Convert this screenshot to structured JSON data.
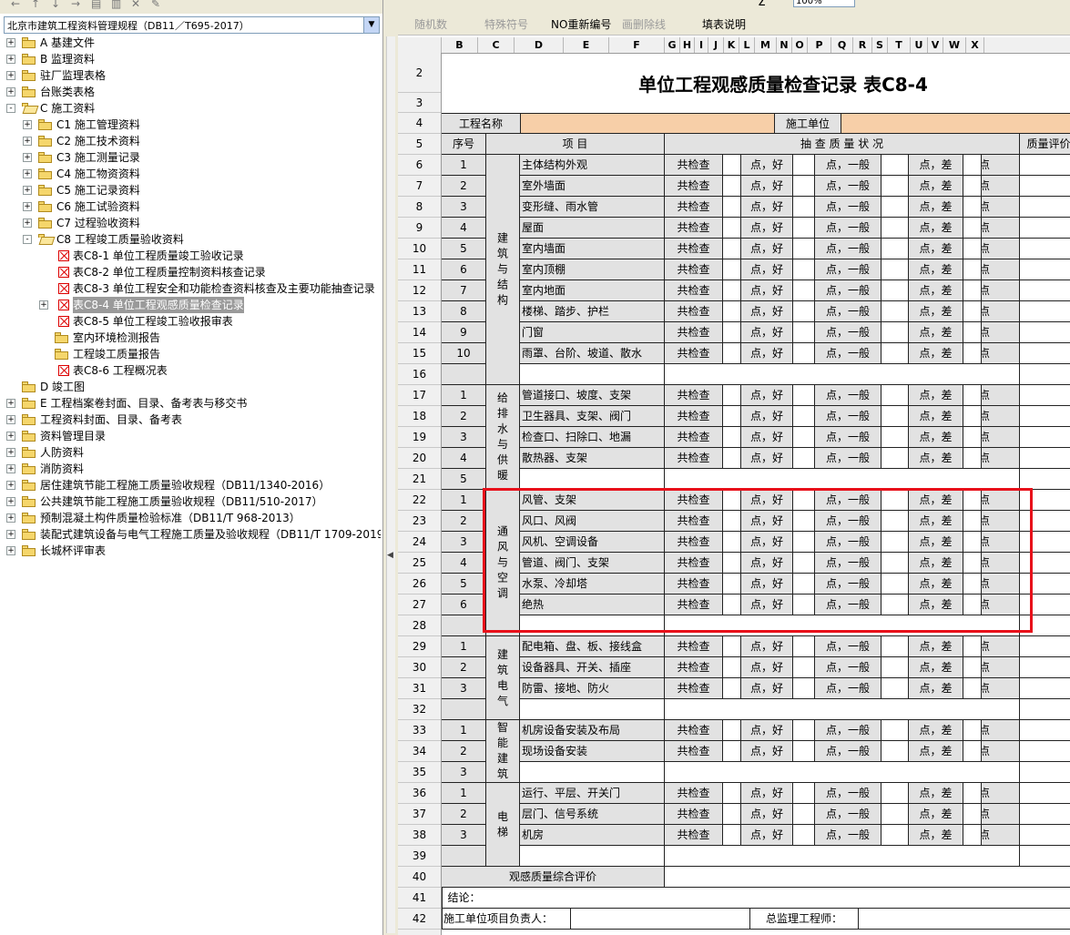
{
  "left_panel": {
    "toolbar_glyphs": [
      "←",
      "↑",
      "↓",
      "→",
      "▤",
      "▥",
      "✕",
      "✎"
    ],
    "combo_value": "北京市建筑工程资料管理规程（DB11／T695-2017）",
    "tree": [
      {
        "label": "A 基建文件",
        "level": 0,
        "expander": "+",
        "icon": "folder"
      },
      {
        "label": "B 监理资料",
        "level": 0,
        "expander": "+",
        "icon": "folder"
      },
      {
        "label": "驻厂监理表格",
        "level": 0,
        "expander": "+",
        "icon": "folder"
      },
      {
        "label": "台账类表格",
        "level": 0,
        "expander": "+",
        "icon": "folder"
      },
      {
        "label": "C 施工资料",
        "level": 0,
        "expander": "-",
        "icon": "folder-open"
      },
      {
        "label": "C1 施工管理资料",
        "level": 1,
        "expander": "+",
        "icon": "folder"
      },
      {
        "label": "C2 施工技术资料",
        "level": 1,
        "expander": "+",
        "icon": "folder"
      },
      {
        "label": "C3 施工测量记录",
        "level": 1,
        "expander": "+",
        "icon": "folder"
      },
      {
        "label": "C4 施工物资资料",
        "level": 1,
        "expander": "+",
        "icon": "folder"
      },
      {
        "label": "C5 施工记录资料",
        "level": 1,
        "expander": "+",
        "icon": "folder"
      },
      {
        "label": "C6 施工试验资料",
        "level": 1,
        "expander": "+",
        "icon": "folder"
      },
      {
        "label": "C7 过程验收资料",
        "level": 1,
        "expander": "+",
        "icon": "folder"
      },
      {
        "label": "C8 工程竣工质量验收资料",
        "level": 1,
        "expander": "-",
        "icon": "folder-open"
      },
      {
        "label": "表C8-1 单位工程质量竣工验收记录",
        "level": 2,
        "expander": "",
        "icon": "doc"
      },
      {
        "label": "表C8-2 单位工程质量控制资料核查记录",
        "level": 2,
        "expander": "",
        "icon": "doc"
      },
      {
        "label": "表C8-3 单位工程安全和功能检查资料核查及主要功能抽查记录",
        "level": 2,
        "expander": "",
        "icon": "doc"
      },
      {
        "label": "表C8-4 单位工程观感质量检查记录",
        "level": 2,
        "expander": "+",
        "icon": "doc",
        "selected": true
      },
      {
        "label": "表C8-5 单位工程竣工验收报审表",
        "level": 2,
        "expander": "",
        "icon": "doc"
      },
      {
        "label": "室内环境检测报告",
        "level": 2,
        "expander": "",
        "icon": "folder"
      },
      {
        "label": "工程竣工质量报告",
        "level": 2,
        "expander": "",
        "icon": "folder"
      },
      {
        "label": "表C8-6 工程概况表",
        "level": 2,
        "expander": "",
        "icon": "doc"
      },
      {
        "label": "D 竣工图",
        "level": 0,
        "expander": "",
        "icon": "folder"
      },
      {
        "label": "E 工程档案卷封面、目录、备考表与移交书",
        "level": 0,
        "expander": "+",
        "icon": "folder"
      },
      {
        "label": "工程资料封面、目录、备考表",
        "level": 0,
        "expander": "+",
        "icon": "folder"
      },
      {
        "label": "资料管理目录",
        "level": 0,
        "expander": "+",
        "icon": "folder"
      },
      {
        "label": "人防资料",
        "level": 0,
        "expander": "+",
        "icon": "folder"
      },
      {
        "label": "消防资料",
        "level": 0,
        "expander": "+",
        "icon": "folder"
      },
      {
        "label": "居住建筑节能工程施工质量验收规程（DB11/1340-2016）",
        "level": 0,
        "expander": "+",
        "icon": "folder"
      },
      {
        "label": "公共建筑节能工程施工质量验收规程（DB11/510-2017）",
        "level": 0,
        "expander": "+",
        "icon": "folder"
      },
      {
        "label": "预制混凝土构件质量检验标准（DB11/T 968-2013）",
        "level": 0,
        "expander": "+",
        "icon": "folder"
      },
      {
        "label": "装配式建筑设备与电气工程施工质量及验收规程（DB11/T 1709-2019）",
        "level": 0,
        "expander": "+",
        "icon": "folder"
      },
      {
        "label": "长城杯评审表",
        "level": 0,
        "expander": "+",
        "icon": "folder"
      }
    ]
  },
  "toolbar": {
    "sigma": "Σ",
    "zoom": "100%",
    "items": [
      {
        "label": "随机数",
        "disabled": true
      },
      {
        "label": "特殊符号",
        "disabled": true
      },
      {
        "label": "NO重新编号",
        "disabled": false
      },
      {
        "label": "画删除线",
        "disabled": true
      },
      {
        "label": "填表说明",
        "disabled": false
      }
    ]
  },
  "sheet": {
    "columns": [
      "B",
      "C",
      "D",
      "E",
      "F",
      "G",
      "H",
      "I",
      "J",
      "K",
      "L",
      "M",
      "N",
      "O",
      "P",
      "Q",
      "R",
      "S",
      "T",
      "U",
      "V",
      "W",
      "X"
    ],
    "row_numbers": [
      "2",
      "3",
      "4",
      "5",
      "6",
      "7",
      "8",
      "9",
      "10",
      "11",
      "12",
      "13",
      "14",
      "15",
      "16",
      "17",
      "18",
      "19",
      "20",
      "21",
      "22",
      "23",
      "24",
      "25",
      "26",
      "27",
      "28",
      "29",
      "30",
      "31",
      "32",
      "33",
      "34",
      "35",
      "36",
      "37",
      "38",
      "39",
      "40",
      "41",
      "42"
    ],
    "title": "单位工程观感质量检查记录  表C8-4",
    "project_name_label": "工程名称",
    "contractor_label": "施工单位",
    "hdr_seq": "序号",
    "hdr_item": "项          目",
    "hdr_status": "抽    查    质    量    状    况",
    "hdr_eval": "质量评价",
    "check_total": "共检查",
    "good": "点，好",
    "normal": "点，一般",
    "poor": "点，差",
    "point": "点",
    "groups": [
      {
        "name": "建筑与结构",
        "items": [
          {
            "seq": "1",
            "text": "主体结构外观"
          },
          {
            "seq": "2",
            "text": "室外墙面"
          },
          {
            "seq": "3",
            "text": "变形缝、雨水管"
          },
          {
            "seq": "4",
            "text": "屋面"
          },
          {
            "seq": "5",
            "text": "室内墙面"
          },
          {
            "seq": "6",
            "text": "室内顶棚"
          },
          {
            "seq": "7",
            "text": "室内地面"
          },
          {
            "seq": "8",
            "text": "楼梯、踏步、护栏"
          },
          {
            "seq": "9",
            "text": "门窗"
          },
          {
            "seq": "10",
            "text": "雨罩、台阶、坡道、散水"
          },
          {
            "seq": "",
            "text": ""
          }
        ]
      },
      {
        "name": "给排水与供暖",
        "items": [
          {
            "seq": "1",
            "text": "管道接口、坡度、支架"
          },
          {
            "seq": "2",
            "text": "卫生器具、支架、阀门"
          },
          {
            "seq": "3",
            "text": "检查口、扫除口、地漏"
          },
          {
            "seq": "4",
            "text": "散热器、支架"
          },
          {
            "seq": "5",
            "text": ""
          }
        ]
      },
      {
        "name": "通风与空调",
        "items": [
          {
            "seq": "1",
            "text": "风管、支架"
          },
          {
            "seq": "2",
            "text": "风口、风阀"
          },
          {
            "seq": "3",
            "text": "风机、空调设备"
          },
          {
            "seq": "4",
            "text": "管道、阀门、支架"
          },
          {
            "seq": "5",
            "text": "水泵、冷却塔"
          },
          {
            "seq": "6",
            "text": "绝热"
          },
          {
            "seq": "",
            "text": ""
          }
        ]
      },
      {
        "name": "建筑电气",
        "items": [
          {
            "seq": "1",
            "text": "配电箱、盘、板、接线盒"
          },
          {
            "seq": "2",
            "text": "设备器具、开关、插座"
          },
          {
            "seq": "3",
            "text": "防雷、接地、防火"
          },
          {
            "seq": "",
            "text": ""
          }
        ]
      },
      {
        "name": "智能建筑",
        "items": [
          {
            "seq": "1",
            "text": "机房设备安装及布局"
          },
          {
            "seq": "2",
            "text": "现场设备安装"
          },
          {
            "seq": "3",
            "text": ""
          }
        ]
      },
      {
        "name": "电梯",
        "items": [
          {
            "seq": "1",
            "text": "运行、平层、开关门"
          },
          {
            "seq": "2",
            "text": "层门、信号系统"
          },
          {
            "seq": "3",
            "text": "机房"
          },
          {
            "seq": "",
            "text": ""
          }
        ]
      }
    ],
    "overall_eval": "观感质量综合评价",
    "conclusion": "结论：",
    "contractor_manager": "施工单位项目负责人：",
    "chief_supervisor": "总监理工程师："
  },
  "highlight_color": "#e8101a"
}
